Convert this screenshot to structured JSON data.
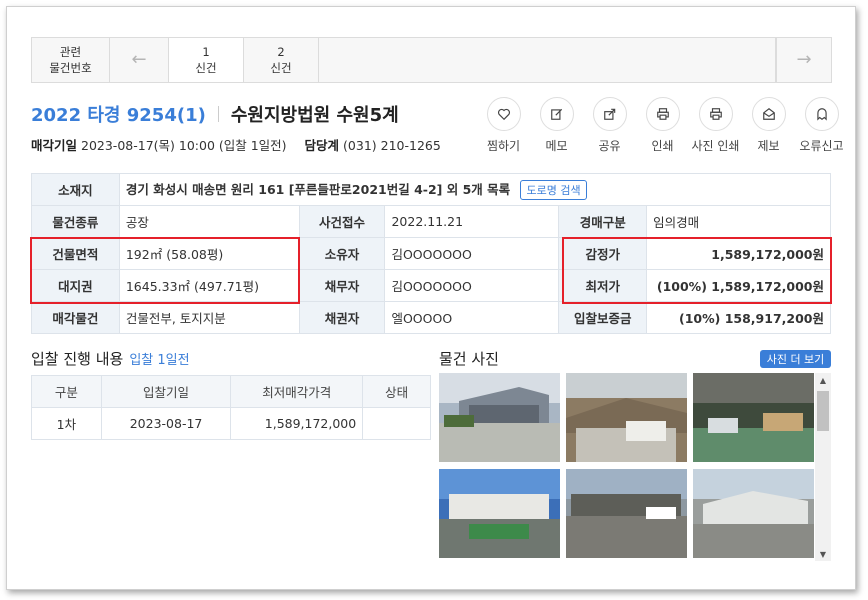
{
  "tabs": {
    "related": [
      "관련",
      "물건번호"
    ],
    "items": [
      {
        "num": "1",
        "label": "신건"
      },
      {
        "num": "2",
        "label": "신건"
      }
    ]
  },
  "header": {
    "case_no": "2022 타경 9254(1)",
    "court": "수원지방법원 수원5계",
    "sale_date_label": "매각기일",
    "sale_date_value": "2023-08-17(목) 10:00 (입찰 1일전)",
    "dept_label": "담당계",
    "dept_value": "(031) 210-1265"
  },
  "actions": [
    "찜하기",
    "메모",
    "공유",
    "인쇄",
    "사진 인쇄",
    "제보",
    "오류신고"
  ],
  "info": {
    "location_label": "소재지",
    "location_value": "경기 화성시 매송면 원리 161 [푸른들판로2021번길 4-2] 외 5개 목록",
    "road_btn": "도로명 검색",
    "type_label": "물건종류",
    "type_value": "공장",
    "received_label": "사건접수",
    "received_value": "2022.11.21",
    "auction_type_label": "경매구분",
    "auction_type_value": "임의경매",
    "building_label": "건물면적",
    "building_value": "192㎡ (58.08평)",
    "owner_label": "소유자",
    "owner_value": "김OOOOOOO",
    "appraisal_label": "감정가",
    "appraisal_value": "1,589,172,000원",
    "land_label": "대지권",
    "land_value": "1645.33㎡ (497.71평)",
    "debtor_label": "채무자",
    "debtor_value": "김OOOOOOO",
    "minimum_label": "최저가",
    "minimum_value": "(100%) 1,589,172,000원",
    "sale_item_label": "매각물건",
    "sale_item_value": "건물전부, 토지지분",
    "creditor_label": "채권자",
    "creditor_value": "엘OOOOO",
    "deposit_label": "입찰보증금",
    "deposit_value": "(10%) 158,917,200원"
  },
  "bidding": {
    "title": "입찰 진행 내용",
    "subtitle": "입찰 1일전",
    "headers": [
      "구분",
      "입찰기일",
      "최저매각가격",
      "상태"
    ],
    "rows": [
      [
        "1차",
        "2023-08-17",
        "1,589,172,000",
        ""
      ]
    ]
  },
  "photos": {
    "title": "물건 사진",
    "more": "사진 더 보기"
  },
  "colors": {
    "accent": "#3a7ed8",
    "highlight_border": "#e5202a",
    "header_bg": "#eef3f8"
  }
}
